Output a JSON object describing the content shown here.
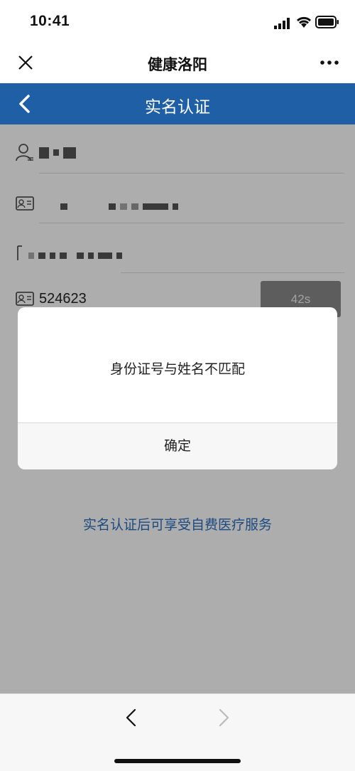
{
  "status_bar": {
    "time": "10:41"
  },
  "wechat_bar": {
    "title": "健康洛阳"
  },
  "page": {
    "title": "实名认证"
  },
  "form": {
    "name_value": "",
    "id_number_value": "",
    "phone_value": "",
    "verify_code_value": "524623",
    "countdown_label": "42s"
  },
  "tip_text": "实名认证后可享受自费医疗服务",
  "dialog": {
    "message": "身份证号与姓名不匹配",
    "confirm_label": "确定"
  },
  "colors": {
    "header_blue": "#1f5fa6",
    "link_blue": "#2b6fbe"
  },
  "icons": {
    "close": "close-icon",
    "more": "more-icon",
    "back": "chevron-left-icon",
    "user": "user-icon",
    "id_card": "id-card-icon",
    "phone": "phone-icon"
  }
}
